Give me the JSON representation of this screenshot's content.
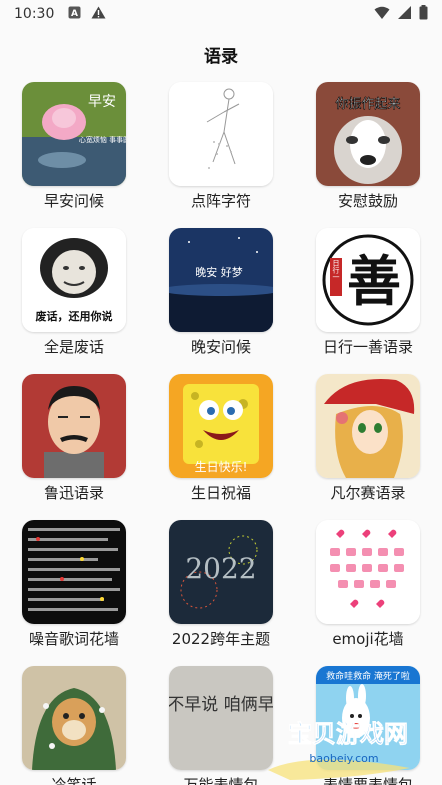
{
  "status_bar": {
    "time": "10:30"
  },
  "header": {
    "title": "语录"
  },
  "tiles": [
    {
      "label": "早安问候",
      "thumb_text": "早安",
      "thumb_text2": "心宽烦恼 事事圆满"
    },
    {
      "label": "点阵字符"
    },
    {
      "label": "安慰鼓励",
      "thumb_text": "你振作起来"
    },
    {
      "label": "全是废话",
      "thumb_text": "废话，还用你说"
    },
    {
      "label": "晚安问候",
      "thumb_text": "晚安  好梦"
    },
    {
      "label": "日行一善语录",
      "thumb_text": "善",
      "thumb_text2": "日行一"
    },
    {
      "label": "鲁迅语录"
    },
    {
      "label": "生日祝福",
      "thumb_text": "生日快乐!"
    },
    {
      "label": "凡尔赛语录"
    },
    {
      "label": "噪音歌词花墙"
    },
    {
      "label": "2022跨年主题",
      "thumb_text": "2022"
    },
    {
      "label": "emoji花墙"
    },
    {
      "label": "冷笑话"
    },
    {
      "label": "万能表情包",
      "thumb_text": "生气不早说 咱俩早以后"
    },
    {
      "label": "表情要表情包",
      "thumb_text": "救命哇救命 淹死了啦"
    }
  ],
  "watermark": {
    "text": "宝贝游戏网",
    "url": "baobeiy.com"
  },
  "colors": {
    "background": "#fafafa",
    "watermark_blue": "#1e88e5"
  }
}
